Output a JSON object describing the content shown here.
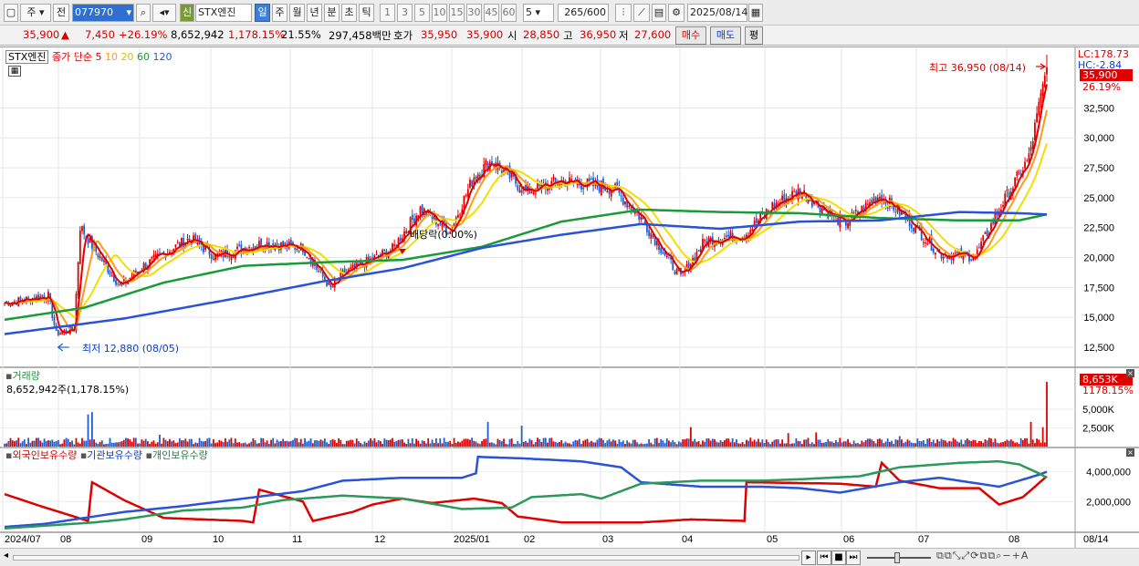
{
  "toolbar": {
    "week_label": "주",
    "prev_label": "전",
    "code": "077970",
    "name": "STX엔진",
    "new_label": "신",
    "periods": [
      "일",
      "주",
      "월",
      "년",
      "분",
      "초",
      "틱"
    ],
    "active_period": "일",
    "intervals": [
      "1",
      "3",
      "5",
      "10",
      "15",
      "30",
      "45",
      "60"
    ],
    "count_input": "5",
    "count": "265",
    "count_max": "/600",
    "date": "2025/08/14"
  },
  "info": {
    "price": "35,900",
    "change_arrow": "▲",
    "change": "7,450",
    "change_pct": "+26.19%",
    "volume": "8,652,942",
    "volume_pct": "1,178.15%",
    "turnover": "21.55%",
    "amount": "297,458백만",
    "quote_label": "호가",
    "ask": "35,950",
    "bid": "35,900",
    "open_label": "시",
    "open": "28,850",
    "high_label": "고",
    "high": "36,950",
    "low_label": "저",
    "low": "27,600",
    "buy_label": "매수",
    "sell_label": "매도",
    "avg_label": "평"
  },
  "price_panel": {
    "stock_label": "STX엔진",
    "ma_legend": "종가 단순",
    "ma_periods": [
      "5",
      "10",
      "20",
      "60",
      "120"
    ],
    "lc": "LC:178.73",
    "hc": "HC:-2.84",
    "last_price": "35,900",
    "last_pct": "26.19%",
    "high_annotation": "최고 36,950 (08/14)",
    "low_annotation": "최저 12,880 (08/05)",
    "dividend_annotation": "배당락(0.00%)"
  },
  "volume_panel": {
    "label": "거래량",
    "value": "8,652,942주(1,178.15%)",
    "last": "8,653K",
    "last_pct": "1178.15%"
  },
  "holding_panel": {
    "series": [
      "외국인보유수량",
      "기관보유수량",
      "개인보유수량"
    ]
  },
  "colors": {
    "up": "#e00000",
    "down": "#1e5fd0",
    "ma5": "#e00000",
    "ma10": "#ff9a1a",
    "ma20": "#f0e000",
    "ma60": "#1a9a3a",
    "ma120": "#2a52d8"
  },
  "chart_data": [
    {
      "type": "candlestick",
      "title": "STX엔진",
      "y_ticks": [
        12500,
        15000,
        17500,
        20000,
        22500,
        25000,
        27500,
        30000,
        32500
      ],
      "y_tick_labels": [
        "12,500",
        "15,000",
        "17,500",
        "20,000",
        "22,500",
        "25,000",
        "27,500",
        "30,000",
        "32,500"
      ],
      "ylim": [
        10900,
        36950
      ],
      "x_labels": [
        "2024/07",
        "08",
        "09",
        "10",
        "11",
        "12",
        "2025/01",
        "02",
        "03",
        "04",
        "05",
        "06",
        "07",
        "08",
        "08/14"
      ],
      "close_anchors": [
        [
          0,
          16200
        ],
        [
          22,
          16800
        ],
        [
          26,
          13600
        ],
        [
          35,
          14100
        ],
        [
          38,
          22600
        ],
        [
          44,
          21000
        ],
        [
          58,
          17600
        ],
        [
          70,
          19300
        ],
        [
          93,
          21600
        ],
        [
          106,
          20100
        ],
        [
          130,
          21200
        ],
        [
          150,
          20800
        ],
        [
          164,
          17400
        ],
        [
          170,
          18600
        ],
        [
          195,
          20700
        ],
        [
          209,
          24100
        ],
        [
          224,
          22200
        ],
        [
          236,
          26800
        ],
        [
          245,
          28100
        ],
        [
          262,
          25500
        ],
        [
          280,
          26400
        ],
        [
          306,
          25800
        ],
        [
          320,
          23300
        ],
        [
          333,
          20000
        ],
        [
          340,
          18300
        ],
        [
          352,
          21400
        ],
        [
          372,
          21900
        ],
        [
          386,
          24300
        ],
        [
          400,
          25600
        ],
        [
          412,
          24000
        ],
        [
          422,
          22800
        ],
        [
          440,
          25200
        ],
        [
          454,
          23200
        ],
        [
          470,
          20300
        ],
        [
          488,
          20100
        ],
        [
          500,
          24000
        ],
        [
          515,
          28300
        ],
        [
          524,
          35900
        ]
      ],
      "ma60_anchors": [
        [
          0,
          14800
        ],
        [
          40,
          15800
        ],
        [
          80,
          17900
        ],
        [
          120,
          19300
        ],
        [
          160,
          19600
        ],
        [
          200,
          19800
        ],
        [
          240,
          20900
        ],
        [
          280,
          23000
        ],
        [
          320,
          24000
        ],
        [
          360,
          23800
        ],
        [
          400,
          23700
        ],
        [
          440,
          23300
        ],
        [
          480,
          23100
        ],
        [
          510,
          23100
        ],
        [
          524,
          23600
        ]
      ],
      "ma120_anchors": [
        [
          0,
          13600
        ],
        [
          60,
          14900
        ],
        [
          120,
          16700
        ],
        [
          160,
          18000
        ],
        [
          200,
          19100
        ],
        [
          240,
          20800
        ],
        [
          280,
          21900
        ],
        [
          320,
          22800
        ],
        [
          360,
          22400
        ],
        [
          400,
          23000
        ],
        [
          440,
          23100
        ],
        [
          480,
          23800
        ],
        [
          510,
          23700
        ],
        [
          524,
          23600
        ]
      ]
    },
    {
      "type": "bar",
      "title": "거래량",
      "y_ticks": [
        2500,
        5000
      ],
      "y_tick_labels": [
        "2,500K",
        "5,000K"
      ],
      "ylim": [
        0,
        9500
      ],
      "spikes": [
        [
          42,
          4300
        ],
        [
          44,
          4600
        ],
        [
          78,
          1600
        ],
        [
          168,
          1100
        ],
        [
          243,
          3300
        ],
        [
          260,
          2800
        ],
        [
          345,
          2600
        ],
        [
          394,
          1800
        ],
        [
          408,
          1900
        ],
        [
          450,
          1400
        ],
        [
          516,
          3300
        ],
        [
          522,
          2600
        ],
        [
          524,
          8653
        ]
      ]
    },
    {
      "type": "line",
      "title": "보유수량",
      "y_ticks": [
        2000000,
        4000000
      ],
      "y_tick_labels": [
        "2,000,000",
        "4,000,000"
      ],
      "ylim": [
        0,
        5200000
      ],
      "series": [
        {
          "name": "외국인보유수량",
          "color": "#e00000",
          "anchors": [
            [
              0,
              2500000
            ],
            [
              18,
              1700000
            ],
            [
              42,
              700000
            ],
            [
              44,
              3300000
            ],
            [
              60,
              2100000
            ],
            [
              80,
              900000
            ],
            [
              120,
              700000
            ],
            [
              125,
              600000
            ],
            [
              128,
              2800000
            ],
            [
              150,
              2000000
            ],
            [
              155,
              700000
            ],
            [
              175,
              1300000
            ],
            [
              185,
              1800000
            ],
            [
              200,
              2200000
            ],
            [
              215,
              1900000
            ],
            [
              236,
              2200000
            ],
            [
              250,
              1900000
            ],
            [
              258,
              1000000
            ],
            [
              280,
              600000
            ],
            [
              320,
              600000
            ],
            [
              345,
              800000
            ],
            [
              372,
              700000
            ],
            [
              373,
              3300000
            ],
            [
              420,
              3200000
            ],
            [
              438,
              3000000
            ],
            [
              441,
              4600000
            ],
            [
              450,
              3400000
            ],
            [
              470,
              2900000
            ],
            [
              490,
              2900000
            ],
            [
              500,
              1800000
            ],
            [
              512,
              2300000
            ],
            [
              524,
              3700000
            ]
          ]
        },
        {
          "name": "기관보유수량",
          "color": "#2a52d8",
          "anchors": [
            [
              0,
              300000
            ],
            [
              20,
              500000
            ],
            [
              45,
              1000000
            ],
            [
              60,
              1300000
            ],
            [
              90,
              1700000
            ],
            [
              120,
              2200000
            ],
            [
              150,
              2700000
            ],
            [
              170,
              3400000
            ],
            [
              200,
              3600000
            ],
            [
              230,
              3600000
            ],
            [
              237,
              3900000
            ],
            [
              238,
              5000000
            ],
            [
              260,
              4900000
            ],
            [
              290,
              4700000
            ],
            [
              310,
              4300000
            ],
            [
              320,
              3300000
            ],
            [
              350,
              3000000
            ],
            [
              380,
              3000000
            ],
            [
              400,
              2900000
            ],
            [
              420,
              2600000
            ],
            [
              450,
              3300000
            ],
            [
              470,
              3600000
            ],
            [
              490,
              3200000
            ],
            [
              500,
              3000000
            ],
            [
              520,
              3800000
            ],
            [
              524,
              4000000
            ]
          ]
        },
        {
          "name": "개인보유수량",
          "color": "#2a9a5a",
          "anchors": [
            [
              0,
              200000
            ],
            [
              45,
              600000
            ],
            [
              60,
              800000
            ],
            [
              90,
              1400000
            ],
            [
              120,
              1600000
            ],
            [
              140,
              2100000
            ],
            [
              170,
              2400000
            ],
            [
              200,
              2200000
            ],
            [
              230,
              1500000
            ],
            [
              255,
              1600000
            ],
            [
              265,
              2300000
            ],
            [
              290,
              2500000
            ],
            [
              300,
              2200000
            ],
            [
              320,
              3200000
            ],
            [
              350,
              3400000
            ],
            [
              380,
              3400000
            ],
            [
              400,
              3500000
            ],
            [
              430,
              3700000
            ],
            [
              450,
              4300000
            ],
            [
              480,
              4600000
            ],
            [
              500,
              4700000
            ],
            [
              510,
              4500000
            ],
            [
              520,
              3900000
            ],
            [
              524,
              3600000
            ]
          ]
        }
      ]
    }
  ]
}
